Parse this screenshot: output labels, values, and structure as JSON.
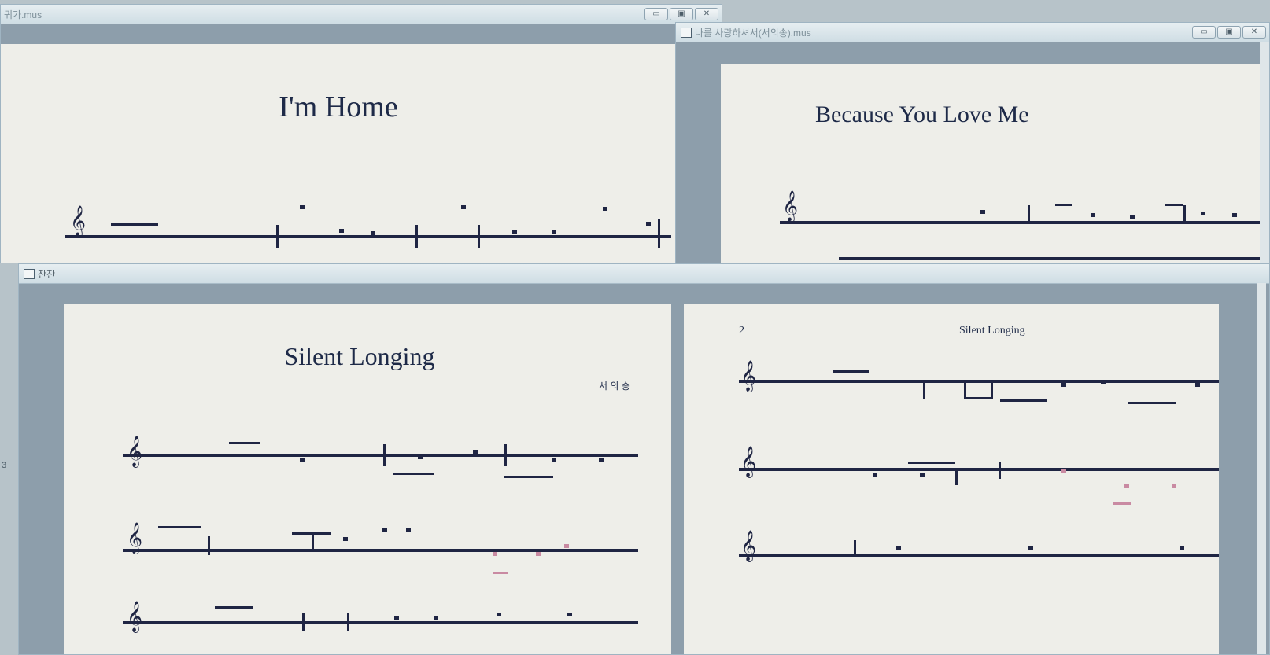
{
  "windows": {
    "home": {
      "title": "귀가.mus",
      "song_title": "I'm Home"
    },
    "love": {
      "title": "나를 사랑하셔서(서의송).mus",
      "song_title": "Because You Love Me"
    },
    "longing": {
      "title": "잔잔",
      "page1_title": "Silent Longing",
      "composer": "서 의 송",
      "page2_number": "2",
      "page2_header": "Silent Longing"
    }
  },
  "controls": {
    "minimize": "▭",
    "maximize": "▣",
    "close": "✕"
  },
  "side_page_indicator": "3"
}
